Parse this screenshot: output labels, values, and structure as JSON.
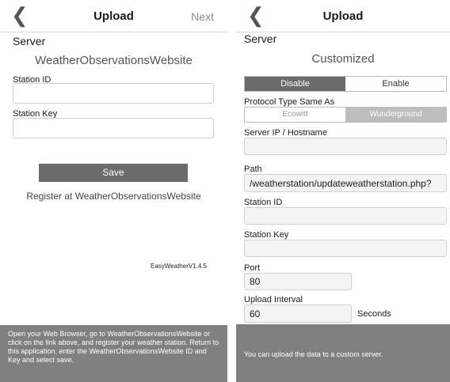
{
  "left": {
    "nav": {
      "back_glyph": "❮",
      "title": "Upload",
      "next_label": "Next"
    },
    "section_title": "Server",
    "server_name": "WeatherObservationsWebsite",
    "fields": [
      {
        "label": "Station ID",
        "value": ""
      },
      {
        "label": "Station Key",
        "value": ""
      }
    ],
    "save_label": "Save",
    "register_link": "Register at WeatherObservationsWebsite",
    "version": "EasyWeatherV1.4.5",
    "instructions": "Open your Web Browser, go to WeatherObservationsWebsite or click on the link above, and register your weather station. Return to this application, enter the WeatherObservationsWebsite ID and Key and select save."
  },
  "right": {
    "nav": {
      "back_glyph": "❮",
      "title": "Upload"
    },
    "section_title": "Server",
    "server_name": "Customized",
    "toggle": {
      "options": [
        "Disable",
        "Enable"
      ],
      "selected": "Disable"
    },
    "protocol": {
      "label": "Protocol Type Same As",
      "options": [
        "Ecowitt",
        "Wunderground"
      ],
      "selected": "Wunderground"
    },
    "fields": {
      "server": {
        "label": "Server IP / Hostname",
        "value": ""
      },
      "path": {
        "label": "Path",
        "value": "/weatherstation/updateweatherstation.php?"
      },
      "station_id": {
        "label": "Station ID",
        "value": ""
      },
      "station_key": {
        "label": "Station Key",
        "value": ""
      },
      "port": {
        "label": "Port",
        "value": "80"
      },
      "interval": {
        "label": "Upload Interval",
        "value": "60",
        "unit": "Seconds"
      }
    },
    "note": "You can upload the data to a custom server."
  },
  "colors": {
    "button_gray": "#6b6b6b",
    "note_background": "#808080",
    "segment_inactive": "#bdbdbd"
  },
  "icons": {
    "back": "chevron-left-icon"
  }
}
